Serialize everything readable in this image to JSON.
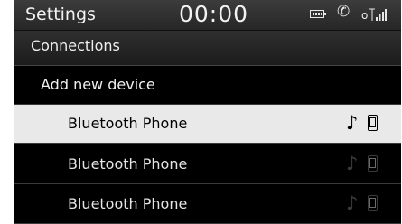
{
  "status_bar": {
    "title": "Settings",
    "time": "00:00"
  },
  "section_header": "Connections",
  "add_device_label": "Add new device",
  "devices": [
    {
      "name": "Bluetooth Phone",
      "selected": true
    },
    {
      "name": "Bluetooth Phone",
      "selected": false
    },
    {
      "name": "Bluetooth Phone",
      "selected": false
    }
  ],
  "icons": {
    "battery": "battery-icon",
    "handsfree": "handsfree-phone-icon",
    "signal": "signal-strength-icon",
    "audio": "music-note-icon",
    "phone": "mobile-phone-icon"
  },
  "colors": {
    "background": "#000000",
    "selected_row": "#e9e9e9",
    "text": "#ffffff"
  }
}
